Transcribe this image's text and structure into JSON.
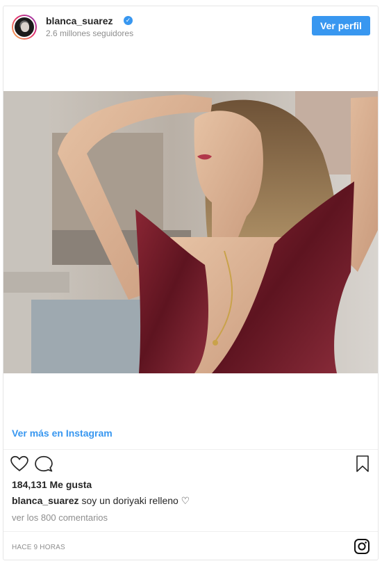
{
  "header": {
    "username": "blanca_suarez",
    "followers": "2.6 millones seguidores",
    "view_profile_label": "Ver perfil",
    "verified_icon": "verified-badge-icon"
  },
  "post": {
    "view_more_label": "Ver más en Instagram",
    "likes": "184,131 Me gusta",
    "caption_user": "blanca_suarez",
    "caption_text": "soy un doriyaki relleno ♡",
    "comments_link": "ver los 800 comentarios",
    "timestamp": "HACE 9 HORAS"
  },
  "icons": {
    "like": "heart-icon",
    "comment": "comment-icon",
    "save": "bookmark-icon",
    "brand": "instagram-icon"
  },
  "colors": {
    "accent": "#3897f0",
    "text": "#262626",
    "muted": "#8e8e8e",
    "border": "#e6e6e6",
    "dress": "#7a1f2b"
  }
}
